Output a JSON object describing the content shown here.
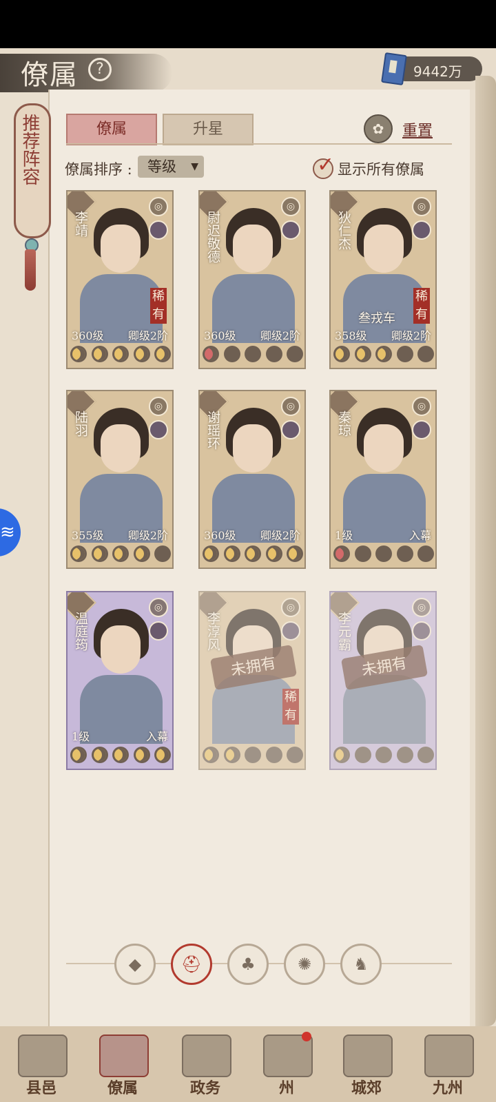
{
  "header": {
    "title": "僚属",
    "currency_value": "9442万"
  },
  "side_tag": {
    "label": "推荐阵容"
  },
  "tabs": [
    {
      "label": "僚属",
      "active": true
    },
    {
      "label": "升星",
      "active": false
    }
  ],
  "reset_label": "重置",
  "sort": {
    "label": "僚属排序 :",
    "value": "等级"
  },
  "show_all": {
    "label": "显示所有僚属",
    "checked": true
  },
  "cards": [
    {
      "name": "李靖",
      "level": "360级",
      "rank": "卿级2阶",
      "rare": "稀有",
      "subtitle": "",
      "stars_on": 5,
      "color": "gold",
      "owned": true,
      "role_icon": "shield-icon"
    },
    {
      "name": "尉迟敬德",
      "level": "360级",
      "rank": "卿级2阶",
      "rare": "",
      "subtitle": "",
      "stars_on": 1,
      "star_type": "red",
      "color": "gold",
      "owned": true,
      "role_icon": "sword-icon"
    },
    {
      "name": "狄仁杰",
      "level": "358级",
      "rank": "卿级2阶",
      "rare": "稀有",
      "subtitle": "叁戎车",
      "stars_on": 3,
      "color": "gold",
      "owned": true,
      "role_icon": "taiji-icon"
    },
    {
      "name": "陆羽",
      "level": "355级",
      "rank": "卿级2阶",
      "rare": "",
      "subtitle": "",
      "stars_on": 4,
      "color": "gold",
      "owned": true,
      "role_icon": "hat-icon"
    },
    {
      "name": "谢瑶环",
      "level": "360级",
      "rank": "卿级2阶",
      "rare": "",
      "subtitle": "",
      "stars_on": 5,
      "color": "gold",
      "owned": true,
      "role_icon": "sword-icon"
    },
    {
      "name": "秦琼",
      "level": "1级",
      "rank": "入幕",
      "rare": "",
      "subtitle": "",
      "stars_on": 1,
      "star_type": "red",
      "color": "gold",
      "owned": true,
      "role_icon": "sword-icon"
    },
    {
      "name": "温庭筠",
      "level": "1级",
      "rank": "入幕",
      "rare": "",
      "subtitle": "",
      "stars_on": 5,
      "color": "purple",
      "owned": true,
      "role_icon": "taiji-icon"
    },
    {
      "name": "李淳风",
      "level": "",
      "rank": "",
      "rare": "稀有",
      "subtitle": "",
      "stars_on": 2,
      "color": "gold",
      "owned": false,
      "stamp": "未拥有",
      "role_icon": "hat-icon"
    },
    {
      "name": "李元霸",
      "level": "",
      "rank": "",
      "rare": "",
      "subtitle": "",
      "stars_on": 1,
      "color": "purple",
      "owned": false,
      "stamp": "未拥有",
      "role_icon": "shield-icon"
    }
  ],
  "filters": [
    {
      "icon": "diamond-icon",
      "active": false
    },
    {
      "icon": "helmet-icon",
      "active": true
    },
    {
      "icon": "gourd-icon",
      "active": false
    },
    {
      "icon": "fan-icon",
      "active": false
    },
    {
      "icon": "horse-icon",
      "active": false
    }
  ],
  "nav": [
    {
      "label": "县邑",
      "active": false
    },
    {
      "label": "僚属",
      "active": true
    },
    {
      "label": "政务",
      "active": false
    },
    {
      "label": "州",
      "active": false,
      "dot": true
    },
    {
      "label": "城郊",
      "active": false
    },
    {
      "label": "九州",
      "active": false
    }
  ]
}
